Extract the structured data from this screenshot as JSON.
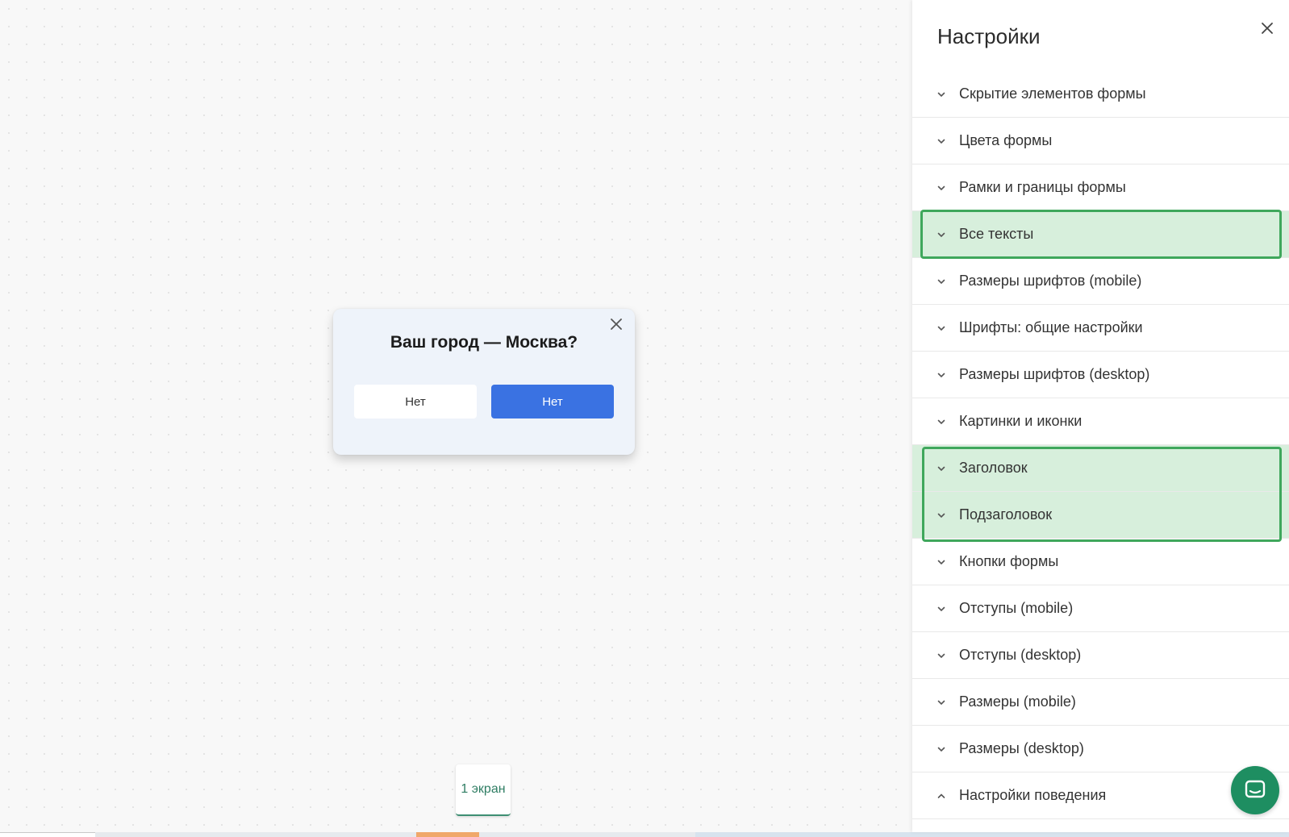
{
  "popup": {
    "title": "Ваш город — Москва?",
    "btn_secondary": "Нет",
    "btn_primary": "Нет"
  },
  "screen_tab": {
    "label": "1 экран"
  },
  "panel": {
    "title": "Настройки",
    "items": [
      {
        "label": "Скрытие элементов формы",
        "expanded": false,
        "highlighted": false
      },
      {
        "label": "Цвета формы",
        "expanded": false,
        "highlighted": false
      },
      {
        "label": "Рамки и границы формы",
        "expanded": false,
        "highlighted": false
      },
      {
        "label": "Все тексты",
        "expanded": false,
        "highlighted": true
      },
      {
        "label": "Размеры шрифтов (mobile)",
        "expanded": false,
        "highlighted": false
      },
      {
        "label": "Шрифты: общие настройки",
        "expanded": false,
        "highlighted": false
      },
      {
        "label": "Размеры шрифтов (desktop)",
        "expanded": false,
        "highlighted": false
      },
      {
        "label": "Картинки и иконки",
        "expanded": false,
        "highlighted": false
      },
      {
        "label": "Заголовок",
        "expanded": false,
        "highlighted": true
      },
      {
        "label": "Подзаголовок",
        "expanded": false,
        "highlighted": true
      },
      {
        "label": "Кнопки формы",
        "expanded": false,
        "highlighted": false
      },
      {
        "label": "Отступы (mobile)",
        "expanded": false,
        "highlighted": false
      },
      {
        "label": "Отступы (desktop)",
        "expanded": false,
        "highlighted": false
      },
      {
        "label": "Размеры (mobile)",
        "expanded": false,
        "highlighted": false
      },
      {
        "label": "Размеры (desktop)",
        "expanded": false,
        "highlighted": false
      },
      {
        "label": "Настройки поведения",
        "expanded": true,
        "highlighted": false
      }
    ]
  },
  "colors": {
    "primary_button": "#3a72e2",
    "highlight_fill": "#d7efdc",
    "highlight_border": "#3fa75c",
    "chat_button": "#1e8e61"
  },
  "icons": {
    "popup_close": "close-icon",
    "panel_close": "close-icon",
    "item_collapsed": "chevron-down-icon",
    "item_expanded": "chevron-up-icon",
    "chat": "chat-icon"
  }
}
